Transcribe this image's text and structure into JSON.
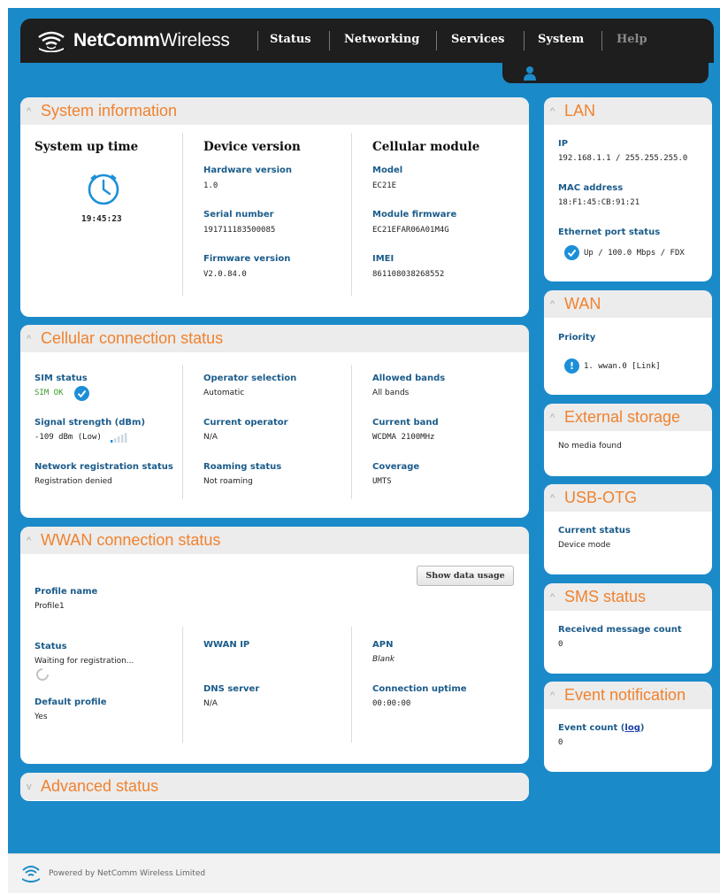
{
  "header": {
    "brand_bold": "NetComm",
    "brand_light": "Wireless",
    "nav": [
      "Status",
      "Networking",
      "Services",
      "System",
      "Help"
    ],
    "user_icon": "user-icon"
  },
  "system_info": {
    "title": "System information",
    "uptime_heading": "System up time",
    "uptime": "19:45:23",
    "device_heading": "Device version",
    "hardware_label": "Hardware version",
    "hardware": "1.0",
    "serial_label": "Serial number",
    "serial": "191711183500085",
    "firmware_label": "Firmware version",
    "firmware": "V2.0.84.0",
    "cellular_heading": "Cellular module",
    "model_label": "Model",
    "model": "EC21E",
    "module_fw_label": "Module firmware",
    "module_fw": "EC21EFAR06A01M4G",
    "imei_label": "IMEI",
    "imei": "861108038268552"
  },
  "cellular": {
    "title": "Cellular connection status",
    "sim_label": "SIM status",
    "sim": "SIM OK",
    "signal_label": "Signal strength (dBm)",
    "signal": "-109 dBm (Low)",
    "netreg_label": "Network registration status",
    "netreg": "Registration denied",
    "opsel_label": "Operator selection",
    "opsel": "Automatic",
    "curop_label": "Current operator",
    "curop": "N/A",
    "roaming_label": "Roaming status",
    "roaming": "Not roaming",
    "bands_label": "Allowed bands",
    "bands": "All bands",
    "curband_label": "Current band",
    "curband": "WCDMA 2100MHz",
    "coverage_label": "Coverage",
    "coverage": "UMTS",
    "signal_bars_level": 1
  },
  "wwan": {
    "title": "WWAN connection status",
    "show_usage": "Show data usage",
    "profile_label": "Profile name",
    "profile": "Profile1",
    "status_label": "Status",
    "status": "Waiting for registration...",
    "default_label": "Default profile",
    "default": "Yes",
    "ip_label": "WWAN IP",
    "dns_label": "DNS server",
    "dns": "N/A",
    "apn_label": "APN",
    "apn": "Blank",
    "uptime_label": "Connection uptime",
    "uptime": "00:00:00"
  },
  "advanced": {
    "title": "Advanced status"
  },
  "lan": {
    "title": "LAN",
    "ip_label": "IP",
    "ip": "192.168.1.1 / 255.255.255.0",
    "mac_label": "MAC address",
    "mac": "18:F1:45:CB:91:21",
    "eth_label": "Ethernet port status",
    "eth": "Up / 100.0 Mbps / FDX"
  },
  "wan": {
    "title": "WAN",
    "priority_label": "Priority",
    "priority": "1. wwan.0 [Link]",
    "priority_badge": "!"
  },
  "storage": {
    "title": "External storage",
    "value": "No media found"
  },
  "usbotg": {
    "title": "USB-OTG",
    "label": "Current status",
    "value": "Device mode"
  },
  "sms": {
    "title": "SMS status",
    "label": "Received message count",
    "value": "0"
  },
  "events": {
    "title": "Event notification",
    "label": "Event count (",
    "link": "log",
    "label_end": ")",
    "value": "0"
  },
  "footer": {
    "text": "Powered by NetComm Wireless Limited"
  },
  "colors": {
    "background": "#1b8ac9",
    "accent_orange": "#f0822e",
    "label_blue": "#1a5b8a",
    "sim_ok_green": "#3a9a2a",
    "check_blue": "#1d8fd8"
  }
}
